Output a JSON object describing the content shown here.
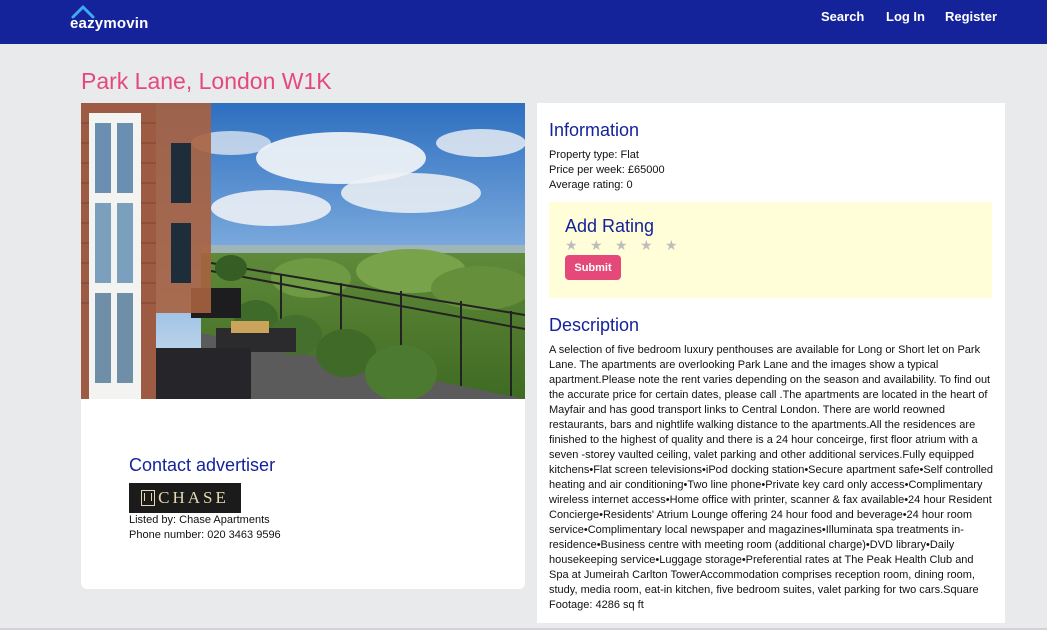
{
  "header": {
    "logo_text": "eazymovin",
    "nav": {
      "search": "Search",
      "login": "Log In",
      "register": "Register"
    },
    "colors": {
      "bar": "#14239a"
    }
  },
  "listing": {
    "title": "Park Lane, London W1K",
    "information": {
      "heading": "Information",
      "property_type": "Property type: Flat",
      "price": "Price per week: £65000",
      "average_rating": "Average rating: 0"
    },
    "rating": {
      "heading": "Add Rating",
      "stars": [
        "star-icon",
        "star-icon",
        "star-icon",
        "star-icon",
        "star-icon"
      ],
      "selected": 0,
      "submit_label": "Submit"
    },
    "description": {
      "heading": "Description",
      "text": "A selection of five bedroom luxury penthouses are available for Long or Short let on Park Lane. The apartments are overlooking Park Lane and the images show a typical apartment.Please note the rent varies depending on the season and availability. To find out the accurate price for certain dates, please call .The apartments are located in the heart of Mayfair and has good transport links to Central London. There are world reowned restaurants, bars and nightlife walking distance to the apartments.All the residences are finished to the highest of quality and there is a 24 hour conceirge, first floor atrium with a seven -storey vaulted ceiling, valet parking and other additional services.Fully equipped kitchens•Flat screen televisions•iPod docking station•Secure apartment safe•Self controlled heating and air conditioning•Two line phone•Private key card only access•Complimentary wireless internet access•Home office with printer, scanner & fax available•24 hour Resident Concierge•Residents' Atrium Lounge offering 24 hour food and beverage•24 hour room service•Complimentary local newspaper and magazines•Illuminata spa treatments in-residence•Business centre with meeting room (additional charge)•DVD library•Daily housekeeping service•Luggage storage•Preferential rates at The Peak Health Club and Spa at Jumeirah Carlton TowerAccommodation comprises reception room, dining room, study, media room, eat-in kitchen, five bedroom suites, valet parking for two cars.Square Footage: 4286 sq ft"
    },
    "contact": {
      "heading": "Contact advertiser",
      "logo_text": "CHASE",
      "listed_by": "Listed by: Chase Apartments",
      "phone": "Phone number: 020 3463 9596"
    }
  }
}
